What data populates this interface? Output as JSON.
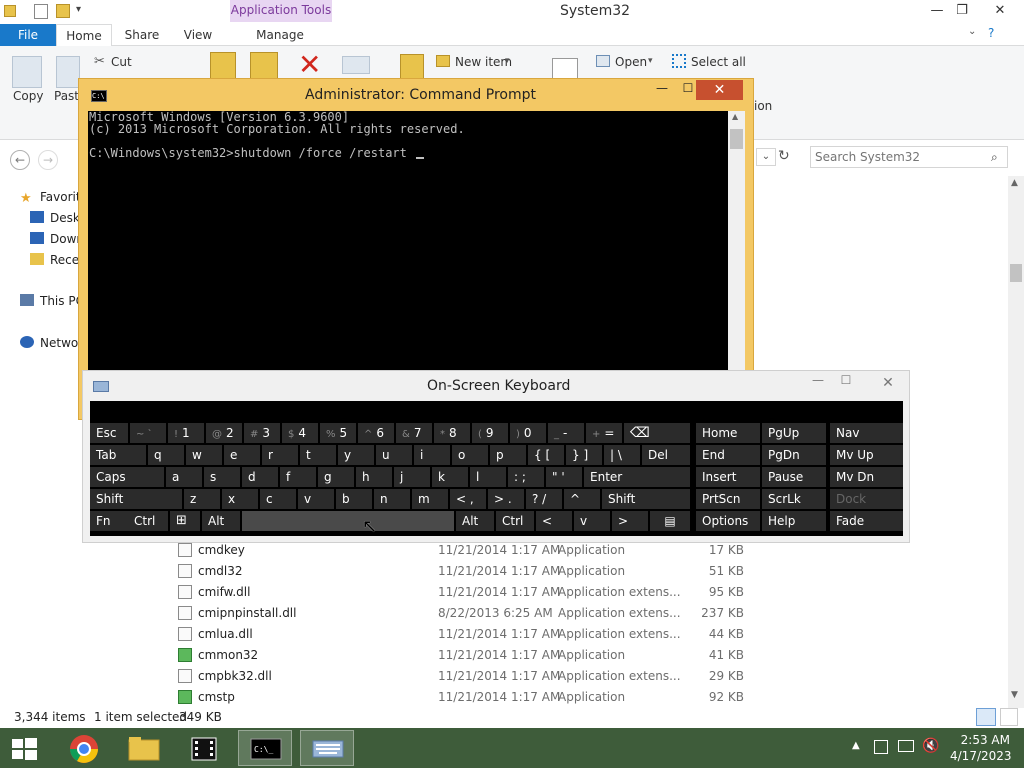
{
  "window": {
    "title": "System32",
    "contextual_tab": "Application Tools"
  },
  "ribbon": {
    "tabs": [
      "File",
      "Home",
      "Share",
      "View",
      "Manage"
    ],
    "copy": "Copy",
    "paste": "Paste",
    "cut": "Cut",
    "new_item": "New item",
    "open": "Open",
    "select_all": "Select all",
    "partial_label": "ion"
  },
  "address": {
    "search_placeholder": "Search System32"
  },
  "nav": {
    "favorites": "Favorit",
    "desktop": "Deskt",
    "downloads": "Down",
    "recent": "Recen",
    "this_pc": "This PC",
    "network": "Networ"
  },
  "cmd": {
    "title": "Administrator:  Command Prompt",
    "lines": [
      "Microsoft Windows [Version 6.3.9600]",
      "(c) 2013 Microsoft Corporation. All rights reserved.",
      "",
      "C:\\Windows\\system32>shutdown /force /restart "
    ]
  },
  "osk": {
    "title": "On-Screen Keyboard",
    "row1": [
      {
        "alt": "",
        "k": "Esc"
      },
      {
        "alt": "~ `",
        "k": ""
      },
      {
        "alt": "!",
        "k": "1"
      },
      {
        "alt": "@",
        "k": "2"
      },
      {
        "alt": "#",
        "k": "3"
      },
      {
        "alt": "$",
        "k": "4"
      },
      {
        "alt": "%",
        "k": "5"
      },
      {
        "alt": "^",
        "k": "6"
      },
      {
        "alt": "&",
        "k": "7"
      },
      {
        "alt": "*",
        "k": "8"
      },
      {
        "alt": "(",
        "k": "9"
      },
      {
        "alt": ")",
        "k": "0"
      },
      {
        "alt": "_",
        "k": "-"
      },
      {
        "alt": "+",
        "k": "="
      },
      {
        "alt": "",
        "k": "⌫"
      }
    ],
    "row2": [
      "Tab",
      "q",
      "w",
      "e",
      "r",
      "t",
      "y",
      "u",
      "i",
      "o",
      "p",
      "{ [",
      "} ]",
      "| \\",
      "Del"
    ],
    "row3": [
      "Caps",
      "a",
      "s",
      "d",
      "f",
      "g",
      "h",
      "j",
      "k",
      "l",
      ": ;",
      "\" '",
      "Enter"
    ],
    "row4": [
      "Shift",
      "z",
      "x",
      "c",
      "v",
      "b",
      "n",
      "m",
      "< ,",
      "> .",
      "? /",
      "^",
      "Shift"
    ],
    "row5": [
      "Fn",
      "Ctrl",
      "⊞",
      "Alt",
      "",
      "Alt",
      "Ctrl",
      "<",
      "v",
      ">",
      "▤"
    ],
    "nav_keys": [
      [
        "Home",
        "PgUp",
        "Nav"
      ],
      [
        "End",
        "PgDn",
        "Mv Up"
      ],
      [
        "Insert",
        "Pause",
        "Mv Dn"
      ],
      [
        "PrtScn",
        "ScrLk",
        "Dock"
      ],
      [
        "Options",
        "Help",
        "Fade"
      ]
    ]
  },
  "files": [
    {
      "name": "cmdkey",
      "date": "11/21/2014 1:17 AM",
      "type": "Application",
      "size": "17 KB"
    },
    {
      "name": "cmdl32",
      "date": "11/21/2014 1:17 AM",
      "type": "Application",
      "size": "51 KB"
    },
    {
      "name": "cmifw.dll",
      "date": "11/21/2014 1:17 AM",
      "type": "Application extens...",
      "size": "95 KB"
    },
    {
      "name": "cmipnpinstall.dll",
      "date": "8/22/2013 6:25 AM",
      "type": "Application extens...",
      "size": "237 KB"
    },
    {
      "name": "cmlua.dll",
      "date": "11/21/2014 1:17 AM",
      "type": "Application extens...",
      "size": "44 KB"
    },
    {
      "name": "cmmon32",
      "date": "11/21/2014 1:17 AM",
      "type": "Application",
      "size": "41 KB"
    },
    {
      "name": "cmpbk32.dll",
      "date": "11/21/2014 1:17 AM",
      "type": "Application extens...",
      "size": "29 KB"
    },
    {
      "name": "cmstp",
      "date": "11/21/2014 1:17 AM",
      "type": "Application",
      "size": "92 KB"
    }
  ],
  "status": {
    "items": "3,344 items",
    "selected": "1 item selected",
    "size": "349 KB"
  },
  "taskbar": {
    "time": "2:53 AM",
    "date": "4/17/2023"
  },
  "colors": {
    "accent": "#1979ca",
    "cmd_frame": "#f3c864",
    "close": "#c7502f",
    "taskbar": "#3e5c3a"
  }
}
